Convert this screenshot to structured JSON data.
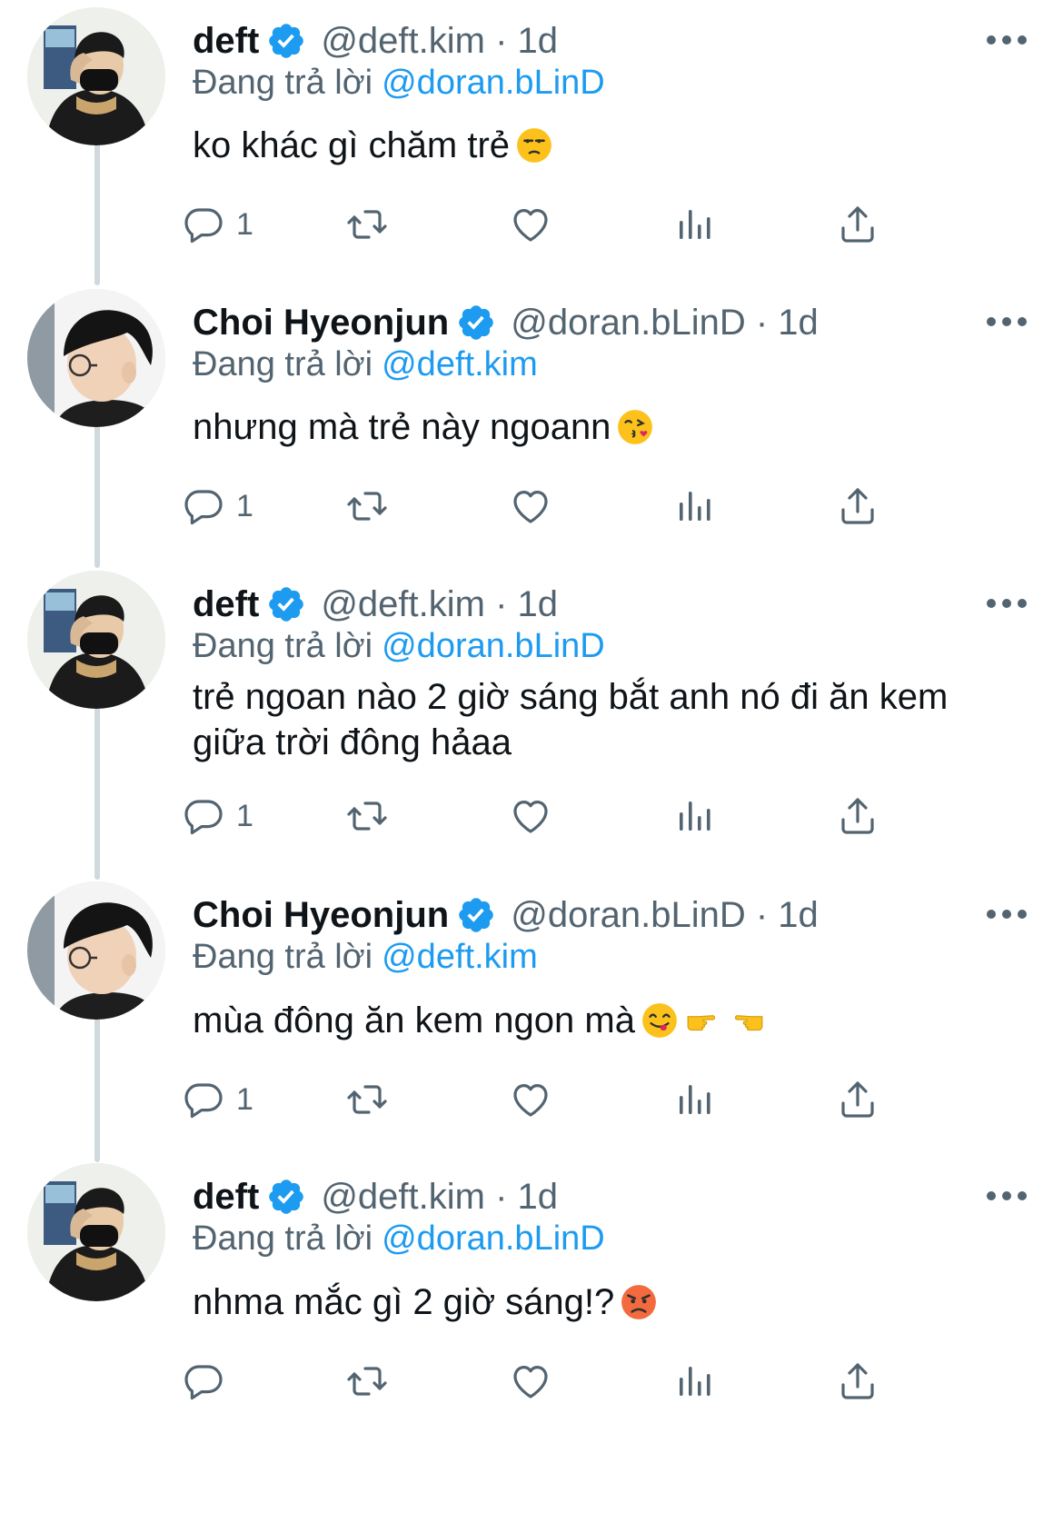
{
  "colors": {
    "accent": "#1d9bf0",
    "muted": "#536471",
    "text": "#0f1419",
    "thread_line": "#cfd9de"
  },
  "reply_prefix": "Đang trả lời",
  "tweets": [
    {
      "name": "deft",
      "handle": "@deft.kim · 1d",
      "reply_to": "@doran.bLinD",
      "text": "ko khác gì chăm trẻ",
      "emojis": [
        "unamused-face"
      ],
      "reply_count": "1",
      "avatar": "deft-avatar"
    },
    {
      "name": "Choi Hyeonjun",
      "handle": "@doran.bLinD · 1d",
      "reply_to": "@deft.kim",
      "text": "nhưng mà trẻ này ngoann",
      "emojis": [
        "kissing-heart-face"
      ],
      "reply_count": "1",
      "avatar": "doran-avatar"
    },
    {
      "name": "deft",
      "handle": "@deft.kim · 1d",
      "reply_to": "@doran.bLinD",
      "text": "trẻ ngoan nào 2 giờ sáng bắt anh nó đi ăn kem giữa trời đông hảaa",
      "emojis": [],
      "reply_count": "1",
      "avatar": "deft-avatar"
    },
    {
      "name": "Choi Hyeonjun",
      "handle": "@doran.bLinD · 1d",
      "reply_to": "@deft.kim",
      "text": "mùa đông ăn kem ngon mà",
      "emojis": [
        "yum-face",
        "pointing-right",
        "pointing-left"
      ],
      "reply_count": "1",
      "avatar": "doran-avatar"
    },
    {
      "name": "deft",
      "handle": "@deft.kim · 1d",
      "reply_to": "@doran.bLinD",
      "text": "nhma mắc gì 2 giờ sáng!?",
      "emojis": [
        "angry-face"
      ],
      "reply_count": "",
      "avatar": "deft-avatar"
    }
  ]
}
